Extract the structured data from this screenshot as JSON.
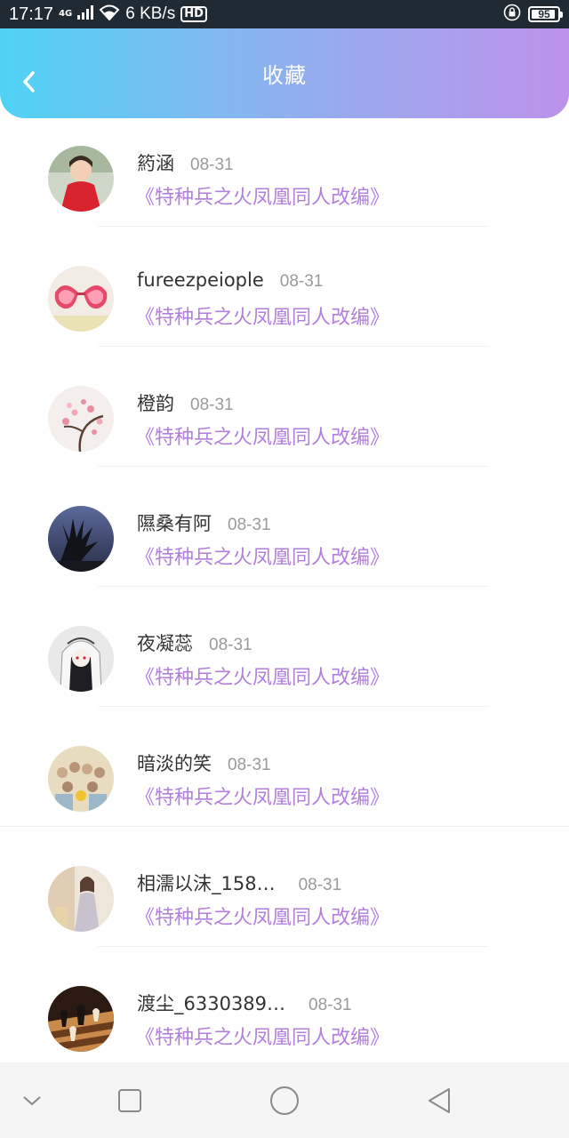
{
  "status_bar": {
    "time": "17:17",
    "network": "4G",
    "speed": "6 KB/s",
    "hd": "HD",
    "battery": "95",
    "battery_level": 0.95
  },
  "header": {
    "title": "收藏",
    "back_icon": "chevron-left-icon"
  },
  "colors": {
    "header_gradient_start": "#4fd3f5",
    "header_gradient_end": "#bd92ea",
    "book_title": "#b27fdc",
    "date": "#9a9a9a"
  },
  "favorites": [
    {
      "user": "箹涵",
      "date": "08-31",
      "book": "《特种兵之火凤凰同人改编》"
    },
    {
      "user": "fureezpeiople",
      "date": "08-31",
      "book": "《特种兵之火凤凰同人改编》"
    },
    {
      "user": "橙韵",
      "date": "08-31",
      "book": "《特种兵之火凤凰同人改编》"
    },
    {
      "user": "隰桑有阿",
      "date": "08-31",
      "book": "《特种兵之火凤凰同人改编》"
    },
    {
      "user": "夜凝蕊",
      "date": "08-31",
      "book": "《特种兵之火凤凰同人改编》"
    },
    {
      "user": "暗淡的笑",
      "date": "08-31",
      "book": "《特种兵之火凤凰同人改编》"
    },
    {
      "user": "相濡以沫_158…",
      "date": "08-31",
      "book": "《特种兵之火凤凰同人改编》"
    },
    {
      "user": "渡尘_6330389…",
      "date": "08-31",
      "book": "《特种兵之火凤凰同人改编》"
    }
  ],
  "nav": {
    "icons": [
      "chevron-down-icon",
      "square-icon",
      "circle-icon",
      "triangle-back-icon"
    ]
  }
}
